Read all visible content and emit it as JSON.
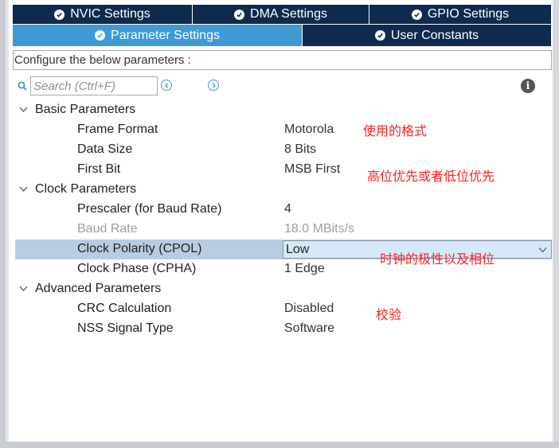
{
  "tabs_row1": [
    {
      "label": "NVIC Settings"
    },
    {
      "label": "DMA Settings"
    },
    {
      "label": "GPIO Settings"
    }
  ],
  "tabs_row2": [
    {
      "label": "Parameter Settings",
      "active": true
    },
    {
      "label": "User Constants"
    }
  ],
  "configure_text": "Configure the below parameters :",
  "search": {
    "placeholder": "Search (Ctrl+F)"
  },
  "groups": {
    "basic": {
      "label": "Basic Parameters"
    },
    "clock": {
      "label": "Clock Parameters"
    },
    "advanced": {
      "label": "Advanced Parameters"
    }
  },
  "params": {
    "frame_format": {
      "name": "Frame Format",
      "value": "Motorola"
    },
    "data_size": {
      "name": "Data Size",
      "value": "8 Bits"
    },
    "first_bit": {
      "name": "First Bit",
      "value": "MSB First"
    },
    "prescaler": {
      "name": "Prescaler (for Baud Rate)",
      "value": "4"
    },
    "baud_rate": {
      "name": "Baud Rate",
      "value": "18.0 MBits/s"
    },
    "cpol": {
      "name": "Clock Polarity (CPOL)",
      "value": "Low"
    },
    "cpha": {
      "name": "Clock Phase (CPHA)",
      "value": "1 Edge"
    },
    "crc": {
      "name": "CRC Calculation",
      "value": "Disabled"
    },
    "nss": {
      "name": "NSS Signal Type",
      "value": "Software"
    }
  },
  "annotations": {
    "frame_format": "使用的格式",
    "first_bit": "高位优先或者低位优先",
    "cpol": "时钟的极性以及相位",
    "crc": "校验"
  },
  "colors": {
    "tab_dark": "#0e2a4f",
    "tab_active": "#3d9ad5",
    "selected_row": "#b9cde2",
    "annotation_red": "#ff2020"
  },
  "icons": {
    "tab_status": "check-circle-icon",
    "search": "search-icon",
    "prev": "chevron-left-circle-icon",
    "next": "chevron-right-circle-icon",
    "info": "info-icon",
    "expand": "chevron-down-icon",
    "dropdown": "dropdown-arrow-icon"
  }
}
